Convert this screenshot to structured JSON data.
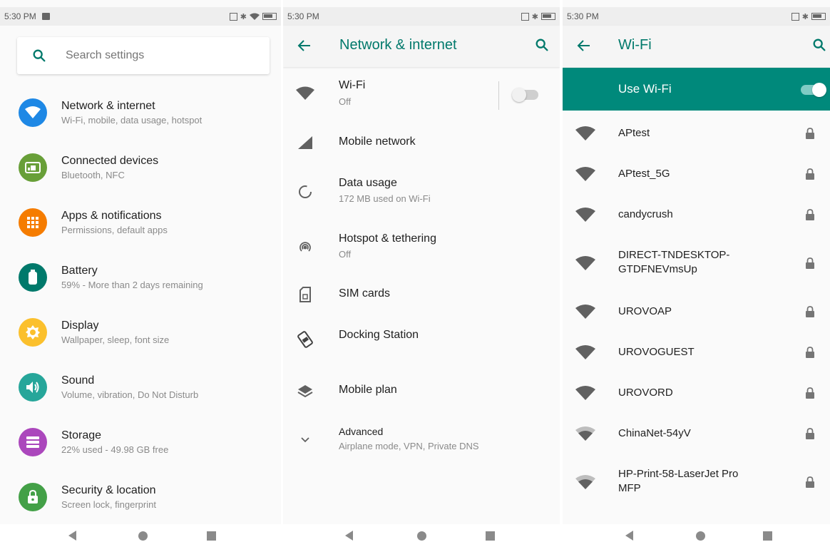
{
  "screen1": {
    "status": {
      "time": "5:30 PM"
    },
    "search": {
      "placeholder": "Search settings"
    },
    "items": [
      {
        "title": "Network & internet",
        "sub": "Wi-Fi, mobile, data usage, hotspot",
        "color": "#1e88e5",
        "icon": "wifi-icon"
      },
      {
        "title": "Connected devices",
        "sub": "Bluetooth, NFC",
        "color": "#689f38",
        "icon": "devices-icon"
      },
      {
        "title": "Apps & notifications",
        "sub": "Permissions, default apps",
        "color": "#f57c00",
        "icon": "apps-grid-icon"
      },
      {
        "title": "Battery",
        "sub": "59% - More than 2 days remaining",
        "color": "#00796b",
        "icon": "battery-icon"
      },
      {
        "title": "Display",
        "sub": "Wallpaper, sleep, font size",
        "color": "#fbc02d",
        "icon": "brightness-icon"
      },
      {
        "title": "Sound",
        "sub": "Volume, vibration, Do Not Disturb",
        "color": "#26a69a",
        "icon": "volume-icon"
      },
      {
        "title": "Storage",
        "sub": "22% used - 49.98 GB free",
        "color": "#ab47bc",
        "icon": "storage-icon"
      },
      {
        "title": "Security & location",
        "sub": "Screen lock, fingerprint",
        "color": "#43a047",
        "icon": "lock-icon"
      }
    ]
  },
  "screen2": {
    "status": {
      "time": "5:30 PM"
    },
    "title": "Network & internet",
    "wifi": {
      "title": "Wi-Fi",
      "sub": "Off",
      "toggle": "off"
    },
    "mobile": {
      "title": "Mobile network"
    },
    "data": {
      "title": "Data usage",
      "sub": "172 MB used on Wi-Fi"
    },
    "hotspot": {
      "title": "Hotspot & tethering",
      "sub": "Off"
    },
    "sim": {
      "title": "SIM cards"
    },
    "docking": {
      "title": "Docking Station"
    },
    "plan": {
      "title": "Mobile plan"
    },
    "advanced": {
      "title": "Advanced",
      "sub": "Airplane mode, VPN, Private DNS"
    }
  },
  "screen3": {
    "status": {
      "time": "5:30 PM"
    },
    "title": "Wi-Fi",
    "use_wifi": {
      "label": "Use Wi-Fi",
      "toggle": "on"
    },
    "networks": [
      {
        "ssid": "APtest",
        "signal": "full",
        "secured": true
      },
      {
        "ssid": "APtest_5G",
        "signal": "full",
        "secured": true
      },
      {
        "ssid": "candycrush",
        "signal": "full",
        "secured": true
      },
      {
        "ssid": "DIRECT-TNDESKTOP-GTDFNEVmsUp",
        "line1": "DIRECT-TNDESKTOP-",
        "line2": "GTDFNEVmsUp",
        "signal": "full",
        "secured": true
      },
      {
        "ssid": "UROVOAP",
        "signal": "full",
        "secured": true
      },
      {
        "ssid": "UROVOGUEST",
        "signal": "full",
        "secured": true
      },
      {
        "ssid": "UROVORD",
        "signal": "full",
        "secured": true
      },
      {
        "ssid": "ChinaNet-54yV",
        "signal": "medium",
        "secured": true
      },
      {
        "ssid": "HP-Print-58-LaserJet Pro MFP",
        "line1": "HP-Print-58-LaserJet Pro",
        "line2": "MFP",
        "signal": "medium",
        "secured": true
      }
    ]
  },
  "colors": {
    "accent": "#00796b",
    "accent_bar": "#00897b",
    "icon_gray": "#616161"
  }
}
